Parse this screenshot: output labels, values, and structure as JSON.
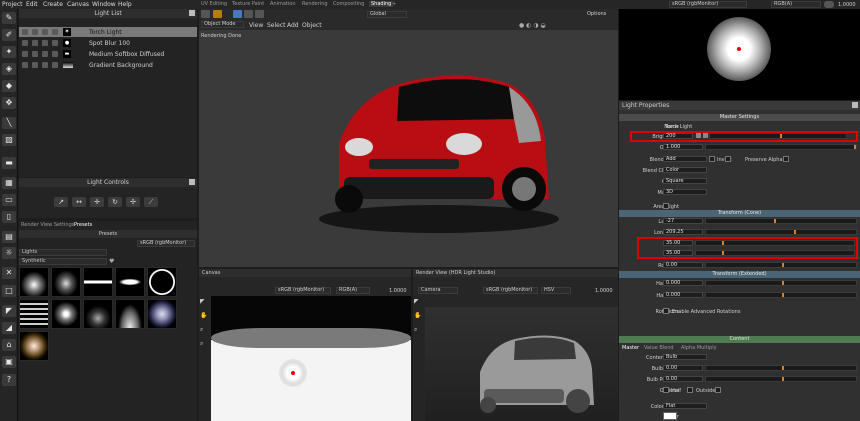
{
  "menubar": {
    "items": [
      "Project",
      "Edit",
      "Create",
      "Canvas",
      "Window",
      "Help"
    ]
  },
  "workspace_tabs": [
    "UV Editing",
    "Texture Paint",
    "Animation",
    "Rendering",
    "Compositing",
    "Shading",
    "+"
  ],
  "topright": {
    "colorspace": "sRGB (rgbMonitor)",
    "channel": "RGB(A)",
    "zoom": "1.0000"
  },
  "light_list": {
    "title": "Light List",
    "items": [
      "Torch Light",
      "Spot Blur 100",
      "Medium Softbox Diffused",
      "Gradient Background"
    ]
  },
  "light_controls": {
    "title": "Light Controls"
  },
  "presets": {
    "tabs": [
      "Render View Settings",
      "Presets"
    ],
    "colorspace": "sRGB (rgbMonitor)",
    "category": "Lights",
    "subcategory": "Synthetic"
  },
  "viewport": {
    "mode": "Object Mode",
    "menu": [
      "View",
      "Select",
      "Add",
      "Object"
    ],
    "orientation": "Global",
    "options": "Options",
    "status": "Rendering Done"
  },
  "canvas": {
    "title": "Canvas",
    "colorspace": "sRGB (rgbMonitor)",
    "channel": "RGB(A)",
    "zoom": "1.0000"
  },
  "render_view": {
    "title": "Render View (HDR Light Studio)",
    "camera": "Camera",
    "colorspace": "sRGB (rgbMonitor)",
    "mode": "HSV",
    "zoom": "1.0000"
  },
  "properties": {
    "title": "Light Properties",
    "master_settings": "Master Settings",
    "name_label": "Name",
    "name": "Torch Light",
    "brightness_label": "Brightness",
    "brightness": "200",
    "opacity_label": "Opacity",
    "opacity": "1.000",
    "blend_mode_label": "Blend Mode",
    "blend_mode": "Add",
    "invert": "Invert",
    "preserve_alpha": "Preserve Alpha",
    "blend_channel_label": "Blend Channel",
    "blend_channel": "Color",
    "cookie_label": "Cookie",
    "cookie": "Square",
    "mapping_label": "Mapping",
    "mapping": "3D",
    "area_light": "Area Light",
    "transform_cone": "Transform (Cone)",
    "latitude_label": "Latitude",
    "latitude": "-27",
    "longitude_label": "Longitude",
    "longitude": "209.25",
    "width_label": "Width",
    "width": "35.00",
    "height_label": "Height",
    "height": "35.00",
    "rotation_label": "Rotation",
    "rotation": "0.00",
    "transform_extended": "Transform (Extended)",
    "handle_u_label": "Handle U",
    "handle_u": "0.000",
    "handle_v_label": "Handle V",
    "handle_v": "0.000",
    "rotations_label": "Rotations",
    "enable_adv": "Enable Advanced Rotations",
    "content": "Content",
    "content_tabs": [
      "Master",
      "Value Blend",
      "Alpha Multiply"
    ],
    "content_type_label": "Content Type",
    "content_type": "Bulb",
    "bulb_width_label": "Bulb Width",
    "bulb_width": "0.00",
    "bulb_position_label": "Bulb Position",
    "bulb_position": "0.00",
    "options_label": "Options",
    "opt_half": "Half",
    "opt_outside": "Outside",
    "color_mode_label": "Color Mode",
    "color_mode": "Flat",
    "color_label": "Color"
  }
}
